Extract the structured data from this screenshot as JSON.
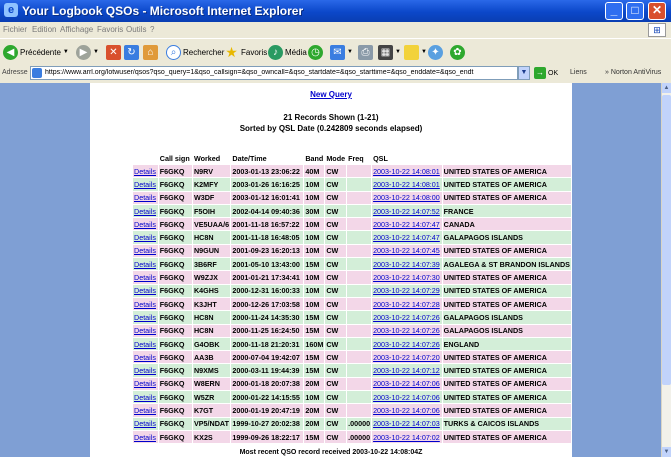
{
  "window": {
    "title": "Your Logbook QSOs - Microsoft Internet Explorer",
    "min": "_",
    "max": "□",
    "close": "✕"
  },
  "menu": [
    "Fichier",
    "Edition",
    "Affichage",
    "Favoris",
    "Outils",
    "?"
  ],
  "toolbar": {
    "back": "Précédente",
    "search": "Rechercher",
    "favorites": "Favoris",
    "media": "Média"
  },
  "address": {
    "label": "Adresse",
    "url": "https://www.arrl.org/lotwuser/qsos?qso_query=1&qso_callsign=&qso_owncall=&qso_startdate=&qso_starttime=&qso_enddate=&qso_endt",
    "go": "OK",
    "links": "Liens",
    "extra": "» Norton AntiVirus"
  },
  "page": {
    "new_query": "New Query",
    "records_shown": "21 Records Shown (1-21)",
    "sorted_by": "Sorted by QSL Date (0.242809 seconds elapsed)",
    "footer": "Most recent QSO record received 2003-10-22 14:08:04Z"
  },
  "table": {
    "headers": [
      "",
      "Call sign",
      "Worked",
      "Date/Time",
      "Band",
      "Mode",
      "Freq",
      "QSL",
      ""
    ],
    "rows": [
      {
        "details": "Details",
        "call": "F6GKQ",
        "worked": "N9RV",
        "datetime": "2003-01-13 23:06:22",
        "band": "40M",
        "mode": "CW",
        "freq": "",
        "qsl": "2003-10-22 14:08:01",
        "country": "UNITED STATES OF AMERICA"
      },
      {
        "details": "Details",
        "call": "F6GKQ",
        "worked": "K2MFY",
        "datetime": "2003-01-26 16:16:25",
        "band": "10M",
        "mode": "CW",
        "freq": "",
        "qsl": "2003-10-22 14:08:01",
        "country": "UNITED STATES OF AMERICA"
      },
      {
        "details": "Details",
        "call": "F6GKQ",
        "worked": "W3DF",
        "datetime": "2003-01-12 16:01:41",
        "band": "10M",
        "mode": "CW",
        "freq": "",
        "qsl": "2003-10-22 14:08:00",
        "country": "UNITED STATES OF AMERICA"
      },
      {
        "details": "Details",
        "call": "F6GKQ",
        "worked": "F5OIH",
        "datetime": "2002-04-14 09:40:36",
        "band": "30M",
        "mode": "CW",
        "freq": "",
        "qsl": "2003-10-22 14:07:52",
        "country": "FRANCE"
      },
      {
        "details": "Details",
        "call": "F6GKQ",
        "worked": "VE5UAA/6",
        "datetime": "2001-11-18 16:57:22",
        "band": "10M",
        "mode": "CW",
        "freq": "",
        "qsl": "2003-10-22 14:07:47",
        "country": "CANADA"
      },
      {
        "details": "Details",
        "call": "F6GKQ",
        "worked": "HC8N",
        "datetime": "2001-11-18 16:48:05",
        "band": "10M",
        "mode": "CW",
        "freq": "",
        "qsl": "2003-10-22 14:07:47",
        "country": "GALAPAGOS ISLANDS"
      },
      {
        "details": "Details",
        "call": "F6GKQ",
        "worked": "N9GUN",
        "datetime": "2001-09-23 16:20:13",
        "band": "10M",
        "mode": "CW",
        "freq": "",
        "qsl": "2003-10-22 14:07:45",
        "country": "UNITED STATES OF AMERICA"
      },
      {
        "details": "Details",
        "call": "F6GKQ",
        "worked": "3B6RF",
        "datetime": "2001-05-10 13:43:00",
        "band": "15M",
        "mode": "CW",
        "freq": "",
        "qsl": "2003-10-22 14:07:39",
        "country": "AGALEGA & ST BRANDON ISLANDS"
      },
      {
        "details": "Details",
        "call": "F6GKQ",
        "worked": "W9ZJX",
        "datetime": "2001-01-21 17:34:41",
        "band": "10M",
        "mode": "CW",
        "freq": "",
        "qsl": "2003-10-22 14:07:30",
        "country": "UNITED STATES OF AMERICA"
      },
      {
        "details": "Details",
        "call": "F6GKQ",
        "worked": "K4GHS",
        "datetime": "2000-12-31 16:00:33",
        "band": "10M",
        "mode": "CW",
        "freq": "",
        "qsl": "2003-10-22 14:07:29",
        "country": "UNITED STATES OF AMERICA"
      },
      {
        "details": "Details",
        "call": "F6GKQ",
        "worked": "K3JHT",
        "datetime": "2000-12-26 17:03:58",
        "band": "10M",
        "mode": "CW",
        "freq": "",
        "qsl": "2003-10-22 14:07:28",
        "country": "UNITED STATES OF AMERICA"
      },
      {
        "details": "Details",
        "call": "F6GKQ",
        "worked": "HC8N",
        "datetime": "2000-11-24 14:35:30",
        "band": "15M",
        "mode": "CW",
        "freq": "",
        "qsl": "2003-10-22 14:07:26",
        "country": "GALAPAGOS ISLANDS"
      },
      {
        "details": "Details",
        "call": "F6GKQ",
        "worked": "HC8N",
        "datetime": "2000-11-25 16:24:50",
        "band": "15M",
        "mode": "CW",
        "freq": "",
        "qsl": "2003-10-22 14:07:26",
        "country": "GALAPAGOS ISLANDS"
      },
      {
        "details": "Details",
        "call": "F6GKQ",
        "worked": "G4OBK",
        "datetime": "2000-11-18 21:20:31",
        "band": "160M",
        "mode": "CW",
        "freq": "",
        "qsl": "2003-10-22 14:07:26",
        "country": "ENGLAND"
      },
      {
        "details": "Details",
        "call": "F6GKQ",
        "worked": "AA3B",
        "datetime": "2000-07-04 19:42:07",
        "band": "15M",
        "mode": "CW",
        "freq": "",
        "qsl": "2003-10-22 14:07:20",
        "country": "UNITED STATES OF AMERICA"
      },
      {
        "details": "Details",
        "call": "F6GKQ",
        "worked": "N9XMS",
        "datetime": "2000-03-11 19:44:39",
        "band": "15M",
        "mode": "CW",
        "freq": "",
        "qsl": "2003-10-22 14:07:12",
        "country": "UNITED STATES OF AMERICA"
      },
      {
        "details": "Details",
        "call": "F6GKQ",
        "worked": "W8ERN",
        "datetime": "2000-01-18 20:07:38",
        "band": "20M",
        "mode": "CW",
        "freq": "",
        "qsl": "2003-10-22 14:07:06",
        "country": "UNITED STATES OF AMERICA"
      },
      {
        "details": "Details",
        "call": "F6GKQ",
        "worked": "W5ZR",
        "datetime": "2000-01-22 14:15:55",
        "band": "10M",
        "mode": "CW",
        "freq": "",
        "qsl": "2003-10-22 14:07:06",
        "country": "UNITED STATES OF AMERICA"
      },
      {
        "details": "Details",
        "call": "F6GKQ",
        "worked": "K7GT",
        "datetime": "2000-01-19 20:47:19",
        "band": "20M",
        "mode": "CW",
        "freq": "",
        "qsl": "2003-10-22 14:07:06",
        "country": "UNITED STATES OF AMERICA"
      },
      {
        "details": "Details",
        "call": "F6GKQ",
        "worked": "VP5/NDAT",
        "datetime": "1999-10-27 20:02:38",
        "band": "20M",
        "mode": "CW",
        "freq": ".00000",
        "qsl": "2003-10-22 14:07:03",
        "country": "TURKS & CAICOS ISLANDS"
      },
      {
        "details": "Details",
        "call": "F6GKQ",
        "worked": "KX2S",
        "datetime": "1999-09-26 18:22:17",
        "band": "15M",
        "mode": "CW",
        "freq": ".00000",
        "qsl": "2003-10-22 14:07:02",
        "country": "UNITED STATES OF AMERICA"
      }
    ]
  },
  "colors": {
    "row_green": "#d3eed8",
    "row_pink": "#f3d7e8",
    "link": "#0000cc",
    "titlebar": "#0b47c9"
  }
}
